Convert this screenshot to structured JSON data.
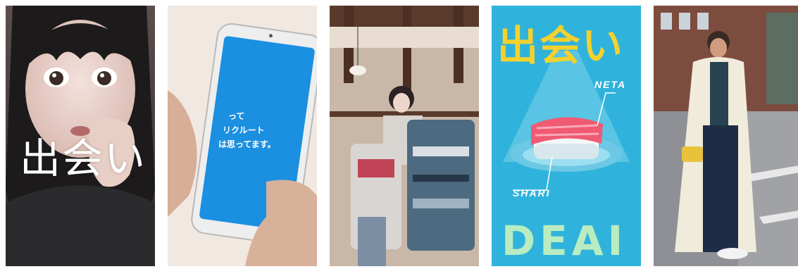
{
  "gallery": {
    "cards": [
      {
        "id": "card-1",
        "overlay_text": "出会い"
      },
      {
        "id": "card-2",
        "phone_text_lines": [
          "って",
          "リクルート",
          "は思ってます。"
        ]
      },
      {
        "id": "card-3"
      },
      {
        "id": "card-4",
        "title": "出会い",
        "label_top": "NETA",
        "label_bottom": "SHARI",
        "brand": "DEAI",
        "colors": {
          "background": "#2fb3dc",
          "title": "#f4d12e",
          "brand": "#b9ecc0"
        }
      },
      {
        "id": "card-5"
      }
    ]
  }
}
